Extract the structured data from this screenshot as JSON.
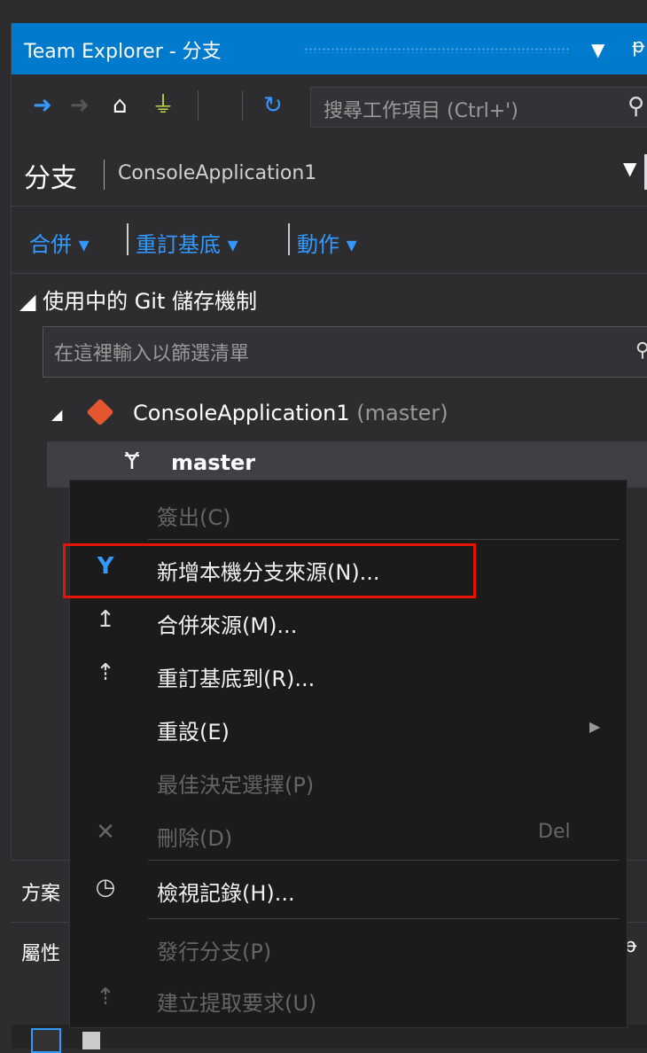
{
  "titlebar": {
    "title": "Team Explorer - 分支",
    "dropdown": "▼",
    "pin": "ᵽ"
  },
  "toolbar": {
    "search_placeholder": "搜尋工作項目 (Ctrl+')"
  },
  "page": {
    "title": "分支",
    "project": "ConsoleApplication1"
  },
  "actions": [
    {
      "label": "合併 ▾"
    },
    {
      "label": "重訂基底 ▾"
    },
    {
      "label": "動作 ▾"
    }
  ],
  "section": {
    "label": "◢ 使用中的 Git 儲存機制"
  },
  "filter": {
    "placeholder": "在這裡輸入以篩選清單"
  },
  "repo": {
    "name": "ConsoleApplication1",
    "branch": "(master)"
  },
  "selected_branch": "master",
  "menu": {
    "items": [
      {
        "label": "簽出(C)",
        "icon": "",
        "enabled": false
      },
      {
        "label": "新增本機分支來源(N)...",
        "icon": "branch-icon",
        "enabled": true
      },
      {
        "label": "合併來源(M)...",
        "icon": "merge-icon",
        "enabled": true
      },
      {
        "label": "重訂基底到(R)...",
        "icon": "rebase-icon",
        "enabled": true
      },
      {
        "label": "重設(E)",
        "icon": "",
        "enabled": true
      },
      {
        "label": "最佳決定選擇(P)",
        "icon": "",
        "enabled": false
      },
      {
        "label": "刪除(D)",
        "icon": "delete-icon",
        "enabled": false,
        "shortcut": "Del"
      },
      {
        "label": "檢視記錄(H)...",
        "icon": "history-icon",
        "enabled": true
      },
      {
        "label": "發行分支(P)",
        "icon": "",
        "enabled": false
      },
      {
        "label": "建立提取要求(U)",
        "icon": "pull-request-icon",
        "enabled": false
      }
    ]
  },
  "lower": {
    "panel1_label": "方案",
    "panel2_label": "屬性",
    "panel2_pin": "ᵽ"
  },
  "colors": {
    "accent": "#007acc",
    "link": "#3399ff",
    "highlight_box": "#e51400",
    "git": "#e4572e"
  }
}
